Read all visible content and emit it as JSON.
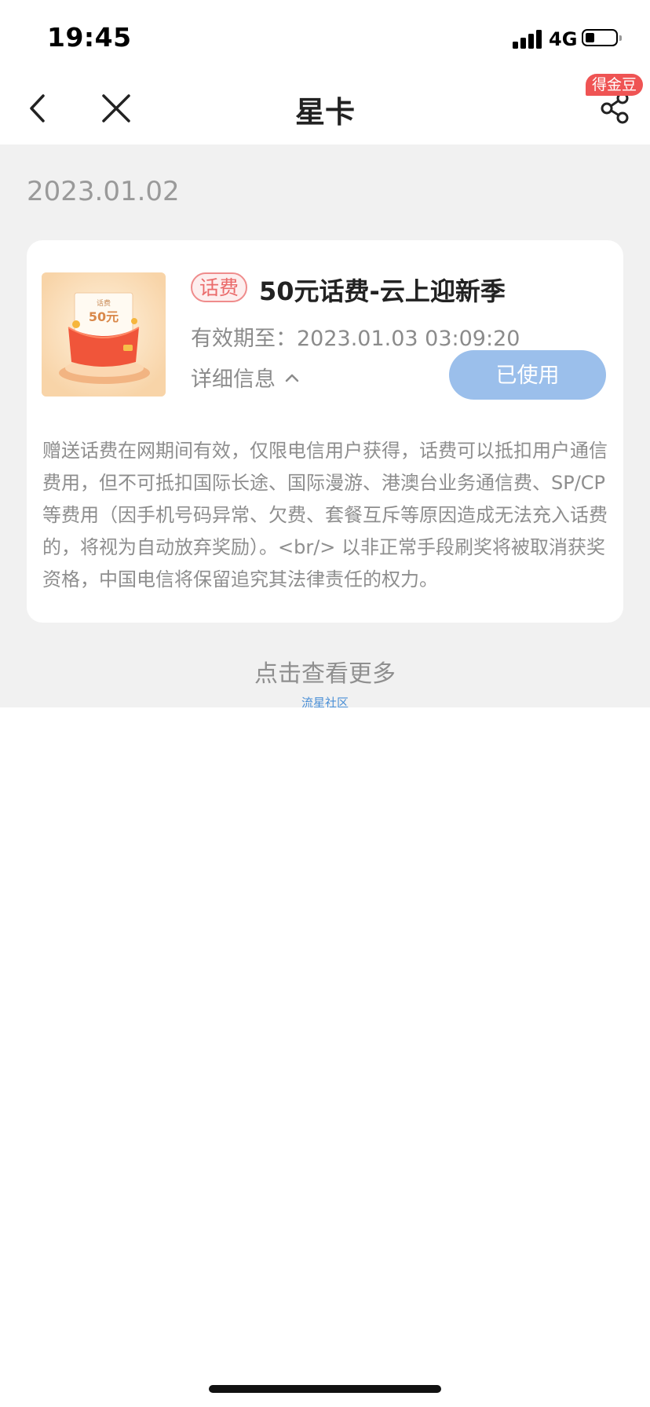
{
  "status_bar": {
    "time": "19:45",
    "network": "4G"
  },
  "nav": {
    "title": "星卡",
    "badge": "得金豆"
  },
  "date_header": "2023.01.02",
  "card": {
    "thumb_top_text": "话费",
    "thumb_amount": "50元",
    "tag": "话费",
    "title": "50元话费-云上迎新季",
    "validity": "有效期至：2023.01.03 03:09:20",
    "detail_label": "详细信息",
    "status_button": "已使用",
    "description": "赠送话费在网期间有效，仅限电信用户获得，话费可以抵扣用户通信费用，但不可抵扣国际长途、国际漫游、港澳台业务通信费、SP/CP等费用（因手机号码异常、欠费、套餐互斥等原因造成无法充入话费的，将视为自动放弃奖励）。<br/> 以非正常手段刷奖将被取消获奖资格，中国电信将保留追究其法律责任的权力。"
  },
  "more_link": "点击查看更多",
  "watermark": "流星社区",
  "colors": {
    "accent_red": "#ef5454",
    "used_button": "#9bbfeb",
    "page_gray": "#f1f1f1"
  }
}
